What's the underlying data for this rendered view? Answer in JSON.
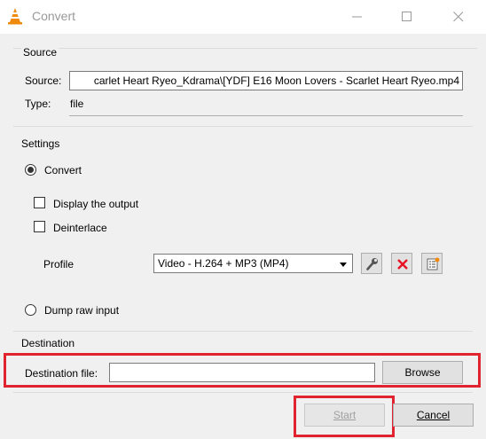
{
  "window": {
    "title": "Convert",
    "icon": "vlc-cone-icon"
  },
  "source": {
    "group_title": "Source",
    "source_label": "Source:",
    "source_value": "carlet Heart Ryeo_Kdrama\\[YDF] E16 Moon Lovers - Scarlet Heart Ryeo.mp4",
    "type_label": "Type:",
    "type_value": "file"
  },
  "settings": {
    "group_title": "Settings",
    "convert_label": "Convert",
    "convert_selected": true,
    "display_output_label": "Display the output",
    "display_output_checked": false,
    "deinterlace_label": "Deinterlace",
    "deinterlace_checked": false,
    "profile_label": "Profile",
    "profile_selected": "Video - H.264 + MP3 (MP4)",
    "profile_buttons": [
      "wrench-icon",
      "delete-x-icon",
      "new-profile-icon"
    ],
    "dump_raw_label": "Dump raw input",
    "dump_raw_selected": false
  },
  "destination": {
    "group_title": "Destination",
    "file_label": "Destination file:",
    "file_value": "",
    "browse_label": "Browse"
  },
  "actions": {
    "start_label": "Start",
    "start_enabled": false,
    "cancel_label": "Cancel"
  },
  "colors": {
    "highlight_red": "#e0232e",
    "vlc_orange": "#f08a0c",
    "delete_red": "#e81123"
  }
}
